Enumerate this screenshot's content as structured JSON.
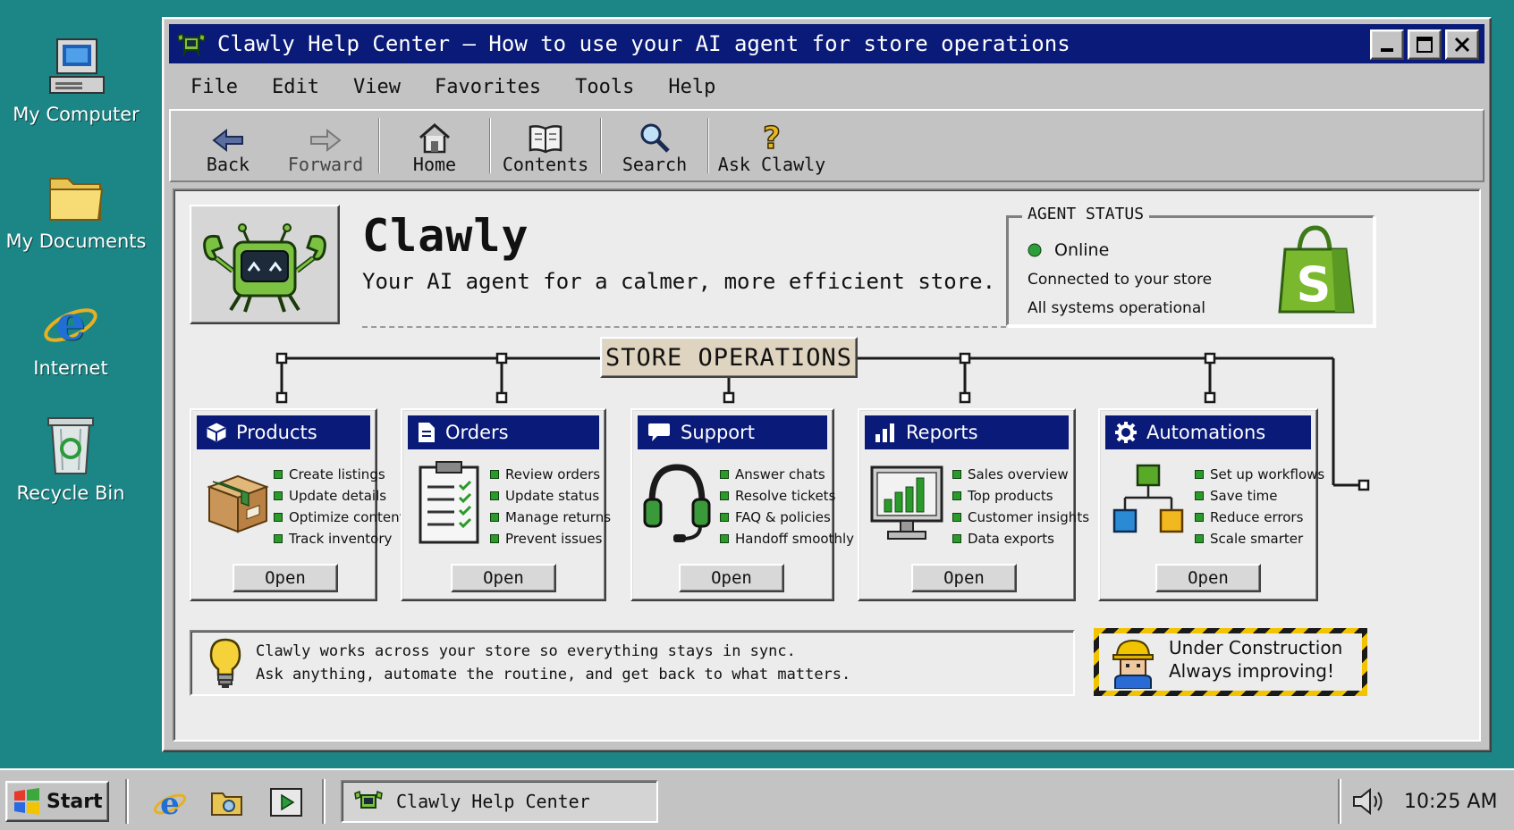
{
  "desktop": {
    "icons": [
      {
        "label": "My Computer",
        "icon": "computer-icon"
      },
      {
        "label": "My Documents",
        "icon": "folder-icon"
      },
      {
        "label": "Internet",
        "icon": "internet-explorer-icon"
      },
      {
        "label": "Recycle Bin",
        "icon": "recycle-bin-icon"
      }
    ]
  },
  "window": {
    "title": "Clawly Help Center – How to use your AI agent for store operations",
    "menu": [
      "File",
      "Edit",
      "View",
      "Favorites",
      "Tools",
      "Help"
    ],
    "toolbar": [
      {
        "label": "Back",
        "icon": "back-arrow-icon"
      },
      {
        "label": "Forward",
        "icon": "forward-arrow-icon"
      },
      {
        "label": "Home",
        "icon": "home-icon"
      },
      {
        "label": "Contents",
        "icon": "book-icon"
      },
      {
        "label": "Search",
        "icon": "magnifier-icon"
      },
      {
        "label": "Ask Clawly",
        "icon": "question-icon"
      }
    ]
  },
  "header": {
    "app_name": "Clawly",
    "tagline": "Your AI agent for a calmer, more efficient store."
  },
  "agent_status": {
    "legend": "AGENT STATUS",
    "state": "Online",
    "connection": "Connected to your store",
    "systems": "All systems operational",
    "state_color": "#2e9e3a"
  },
  "operations": {
    "title": "STORE OPERATIONS",
    "cards": [
      {
        "title": "Products",
        "items": [
          "Create listings",
          "Update details",
          "Optimize content",
          "Track inventory"
        ],
        "button": "Open"
      },
      {
        "title": "Orders",
        "items": [
          "Review orders",
          "Update status",
          "Manage returns",
          "Prevent issues"
        ],
        "button": "Open"
      },
      {
        "title": "Support",
        "items": [
          "Answer chats",
          "Resolve tickets",
          "FAQ & policies",
          "Handoff smoothly"
        ],
        "button": "Open"
      },
      {
        "title": "Reports",
        "items": [
          "Sales overview",
          "Top products",
          "Customer insights",
          "Data exports"
        ],
        "button": "Open"
      },
      {
        "title": "Automations",
        "items": [
          "Set up workflows",
          "Save time",
          "Reduce errors",
          "Scale smarter"
        ],
        "button": "Open"
      }
    ]
  },
  "info": {
    "line1": "Clawly works across your store so everything stays in sync.",
    "line2": "Ask anything, automate the routine, and get back to what matters."
  },
  "construction": {
    "line1": "Under Construction",
    "line2": "Always improving!"
  },
  "taskbar": {
    "start": "Start",
    "active_app": "Clawly Help Center",
    "clock": "10:25 AM"
  },
  "colors": {
    "desktop": "#1c8585",
    "titlebar": "#0a1a78",
    "window": "#c3c3c3"
  }
}
